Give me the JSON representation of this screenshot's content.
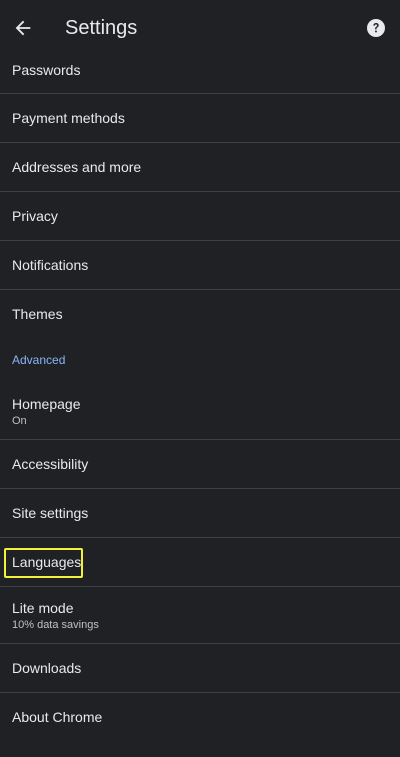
{
  "header": {
    "title": "Settings",
    "back_icon": "arrow-back-icon",
    "help_icon": "help-circle-icon"
  },
  "items": {
    "passwords": "Passwords",
    "payment_methods": "Payment methods",
    "addresses": "Addresses and more",
    "privacy": "Privacy",
    "notifications": "Notifications",
    "themes": "Themes"
  },
  "advanced_header": "Advanced",
  "advanced": {
    "homepage": {
      "label": "Homepage",
      "sub": "On"
    },
    "accessibility": "Accessibility",
    "site_settings": "Site settings",
    "languages": "Languages",
    "lite_mode": {
      "label": "Lite mode",
      "sub": "10% data savings"
    },
    "downloads": "Downloads",
    "about_chrome": "About Chrome"
  },
  "colors": {
    "background": "#202124",
    "text": "#e8eaed",
    "accent": "#8ab4f8",
    "divider": "#3c4043",
    "highlight": "#f1f13a"
  }
}
